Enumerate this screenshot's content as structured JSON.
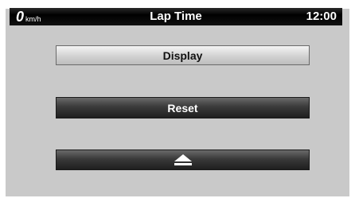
{
  "status_bar": {
    "speed_value": "0",
    "speed_unit": "km/h",
    "title": "Lap Time",
    "clock": "12:00"
  },
  "buttons": {
    "display_label": "Display",
    "reset_label": "Reset",
    "eject_icon": "eject-icon"
  }
}
